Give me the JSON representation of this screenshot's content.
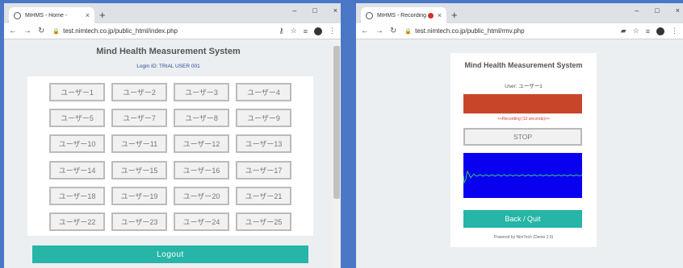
{
  "left_window": {
    "tab": {
      "title": "MiHMS - Home -",
      "close": "×"
    },
    "new_tab": "+",
    "controls": [
      "–",
      "□",
      "×"
    ],
    "toolbar": {
      "back": "←",
      "forward": "→",
      "reload": "↻",
      "url": "test.nimtech.co.jp/public_html/index.php"
    },
    "page": {
      "heading": "Mind Health Measurement System",
      "login_id": "Login ID: TRIAL USER 001",
      "users": [
        "ユーザー1",
        "ユーザー2",
        "ユーザー3",
        "ユーザー4",
        "ユーザー5",
        "ユーザー7",
        "ユーザー8",
        "ユーザー9",
        "ユーザー10",
        "ユーザー11",
        "ユーザー12",
        "ユーザー13",
        "ユーザー14",
        "ユーザー15",
        "ユーザー16",
        "ユーザー17",
        "ユーザー18",
        "ユーザー19",
        "ユーザー20",
        "ユーザー21",
        "ユーザー22",
        "ユーザー23",
        "ユーザー24",
        "ユーザー25"
      ],
      "logout_label": "Logout"
    }
  },
  "right_window": {
    "tab": {
      "title": "MiHMS - Recording -",
      "close": "×"
    },
    "new_tab": "+",
    "controls": [
      "–",
      "□",
      "×"
    ],
    "toolbar": {
      "back": "←",
      "forward": "→",
      "reload": "↻",
      "url": "test.nimtech.co.jp/public_html/rmv.php"
    },
    "page": {
      "heading": "Mind Health Measurement System",
      "user_label": "User: ユーザー1",
      "recording_message": "<<Recording (10 seconds)>>",
      "stop_label": "STOP",
      "back_label": "Back / Quit",
      "powered_by": "Powered by NimTech (Demo 2.5)"
    }
  },
  "colors": {
    "accent": "#26b5a6",
    "record": "#c9452a",
    "waveform_bg": "#0a00f0",
    "waveform_line": "#2ecc71"
  }
}
